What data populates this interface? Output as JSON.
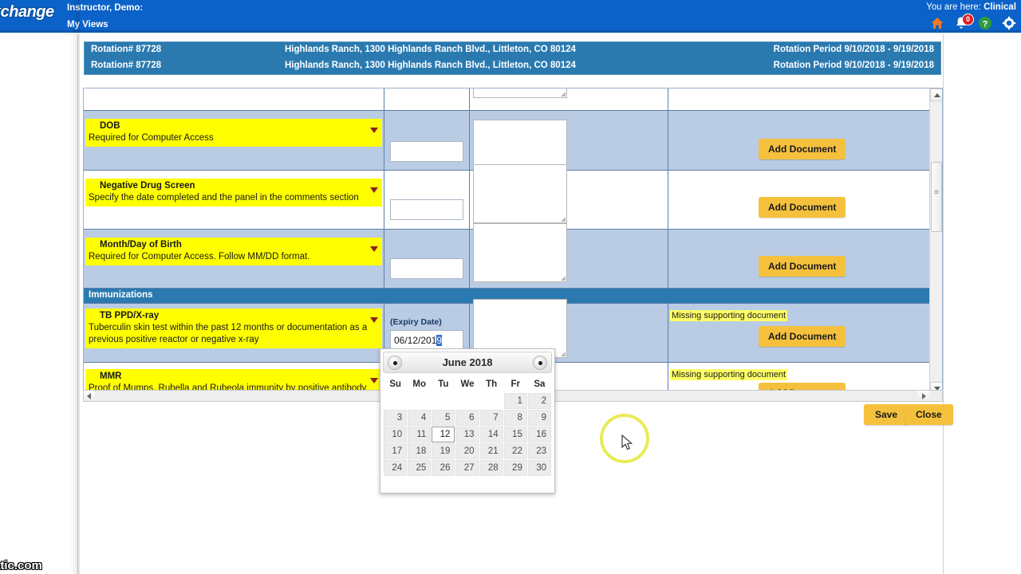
{
  "header": {
    "logo_text": "xchange",
    "user_line": "Instructor, Demo:",
    "my_views": "My Views",
    "you_are_here_prefix": "You are here: ",
    "you_are_here_value": "Clinical",
    "notification_count": "0",
    "icons": [
      "home-icon",
      "notification-bell-icon",
      "help-icon",
      "settings-gear-icon"
    ],
    "bg_color": "#0b62c8"
  },
  "rotation": {
    "rows": [
      {
        "rotation_label": "Rotation#  87728",
        "site": "Highlands Ranch, 1300 Highlands Ranch Blvd., Littleton, CO 80124",
        "period": "Rotation Period 9/10/2018 - 9/19/2018"
      },
      {
        "rotation_label": "Rotation#  87728",
        "site": "Highlands Ranch, 1300 Highlands Ranch Blvd., Littleton, CO 80124",
        "period": "Rotation Period 9/10/2018 - 9/19/2018"
      }
    ],
    "bg_color": "#2a7ab0"
  },
  "table": {
    "requirements": [
      {
        "title": "DOB",
        "description": "Required for Computer Access",
        "date_value": "",
        "date_label": "",
        "missing_text": "",
        "add_document_label": "Add Document",
        "shaded": true
      },
      {
        "title": "Negative Drug Screen",
        "description": "Specify the date completed and the panel in the comments section",
        "date_value": "",
        "date_label": "",
        "missing_text": "",
        "add_document_label": "Add Document",
        "shaded": false
      },
      {
        "title": "Month/Day of Birth",
        "description": "Required for Computer Access. Follow MM/DD format.",
        "date_value": "",
        "date_label": "",
        "missing_text": "",
        "add_document_label": "Add Document",
        "shaded": true
      }
    ],
    "section_header": "Immunizations",
    "immunizations": [
      {
        "title": "TB PPD/X-ray",
        "description": "Tuberculin skin test within the past 12 months or documentation as a previous positive reactor or negative x-ray",
        "date_label": "(Expiry Date)",
        "date_value_text": "06/12/201",
        "date_value_selected": "9",
        "missing_text": "Missing supporting document",
        "add_document_label": "Add Document",
        "shaded": true
      },
      {
        "title": "MMR",
        "description": "Proof of Mumps, Rubella and Rubeola immunity by positive antibody",
        "date_label": "",
        "date_value_text": "",
        "date_value_selected": "",
        "missing_text": "Missing supporting document",
        "add_document_label": "Add Document",
        "shaded": false
      }
    ],
    "yellow_color": "#ffff00",
    "row_tint_color": "#b9cce4"
  },
  "datepicker": {
    "month_title": "June 2018",
    "prev_label": "prev-month",
    "next_label": "next-month",
    "weekdays": [
      "Su",
      "Mo",
      "Tu",
      "We",
      "Th",
      "Fr",
      "Sa"
    ],
    "weeks": [
      [
        "",
        "",
        "",
        "",
        "",
        "1",
        "2"
      ],
      [
        "3",
        "4",
        "5",
        "6",
        "7",
        "8",
        "9"
      ],
      [
        "10",
        "11",
        "12",
        "13",
        "14",
        "15",
        "16"
      ],
      [
        "17",
        "18",
        "19",
        "20",
        "21",
        "22",
        "23"
      ],
      [
        "24",
        "25",
        "26",
        "27",
        "28",
        "29",
        "30"
      ]
    ],
    "selected_day": "12"
  },
  "footer": {
    "save_label": "Save",
    "close_label": "Close",
    "button_color": "#f5c13d"
  },
  "watermark": {
    "text": "atic.com"
  }
}
